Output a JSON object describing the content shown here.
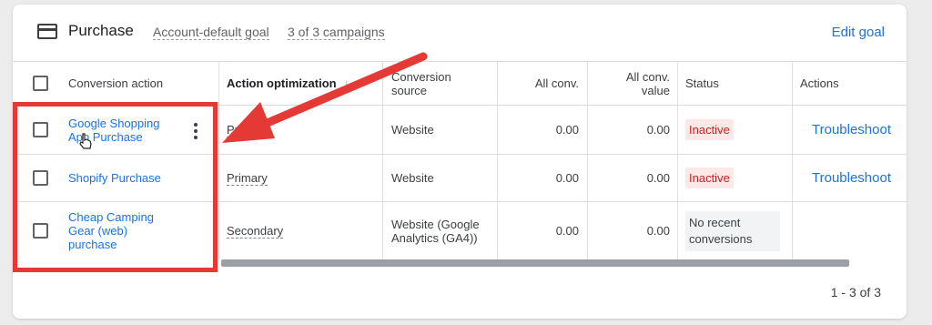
{
  "header": {
    "title": "Purchase",
    "account_default": "Account-default goal",
    "campaigns": "3 of 3 campaigns",
    "edit_goal": "Edit goal"
  },
  "columns": {
    "conversion_action": "Conversion action",
    "action_optimization": "Action optimization",
    "sort_arrow": "↓",
    "conversion_source_line1": "Conversion",
    "conversion_source_line2": "source",
    "all_conv": "All conv.",
    "all_conv_value_line1": "All conv.",
    "all_conv_value_line2": "value",
    "status": "Status",
    "actions": "Actions"
  },
  "rows": [
    {
      "name_line1": "Google Shopping",
      "name_line2": "App Purchase",
      "optimization": "Primary",
      "source_line1": "Website",
      "all_conv": "0.00",
      "all_conv_value": "0.00",
      "status": "Inactive",
      "action": "Troubleshoot"
    },
    {
      "name_line1": "Shopify Purchase",
      "optimization": "Primary",
      "source_line1": "Website",
      "all_conv": "0.00",
      "all_conv_value": "0.00",
      "status": "Inactive",
      "action": "Troubleshoot"
    },
    {
      "name_line1": "Cheap Camping",
      "name_line2": "Gear (web)",
      "name_line3": "purchase",
      "optimization": "Secondary",
      "source_line1": "Website (Google",
      "source_line2": "Analytics (GA4))",
      "all_conv": "0.00",
      "all_conv_value": "0.00",
      "status_line1": "No recent",
      "status_line2": "conversions"
    }
  ],
  "pagination": "1 - 3 of 3",
  "colors": {
    "link": "#1a73e8",
    "inactive_bg": "#fce8e6",
    "inactive_text": "#c5221f",
    "annotation": "#e53935"
  },
  "icons": [
    "credit-card-icon",
    "sort-down-arrow-icon",
    "more-vert-icon",
    "hand-cursor-icon"
  ]
}
